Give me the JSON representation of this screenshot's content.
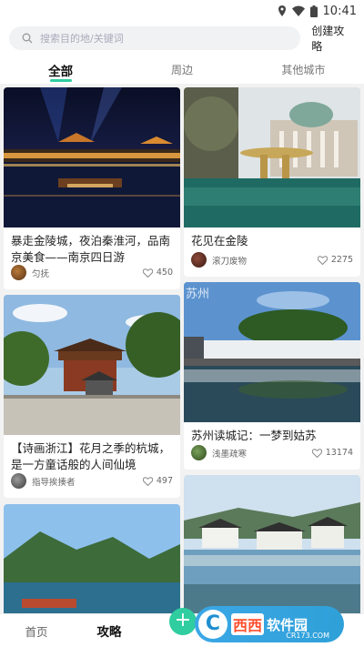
{
  "statusbar": {
    "time": "10:41"
  },
  "search": {
    "placeholder": "搜索目的地/关键词",
    "create_label": "创建攻略"
  },
  "tabs": [
    {
      "label": "全部",
      "active": true
    },
    {
      "label": "周边",
      "active": false
    },
    {
      "label": "其他城市",
      "active": false
    }
  ],
  "cards": [
    {
      "title": "暴走金陵城，夜泊秦淮河，品南京美食——南京四日游",
      "author": "匀抚",
      "likes": "450"
    },
    {
      "title": "花见在金陵",
      "author": "滚刀废物",
      "likes": "2275"
    },
    {
      "title": "【诗画浙江】花月之季的杭城，是一方童话般的人间仙境",
      "author": "指导挨揍者",
      "likes": "497"
    },
    {
      "title": "苏州读城记：一梦到姑苏",
      "author": "浅墨疏寒",
      "likes": "13174",
      "photo_text": "苏州"
    }
  ],
  "bottom_nav": {
    "home": "首页",
    "guide": "攻略"
  },
  "watermark": {
    "brand": "西西",
    "text": "软件园",
    "url": "CR173.COM"
  },
  "colors": {
    "accent": "#2fcd9f"
  }
}
